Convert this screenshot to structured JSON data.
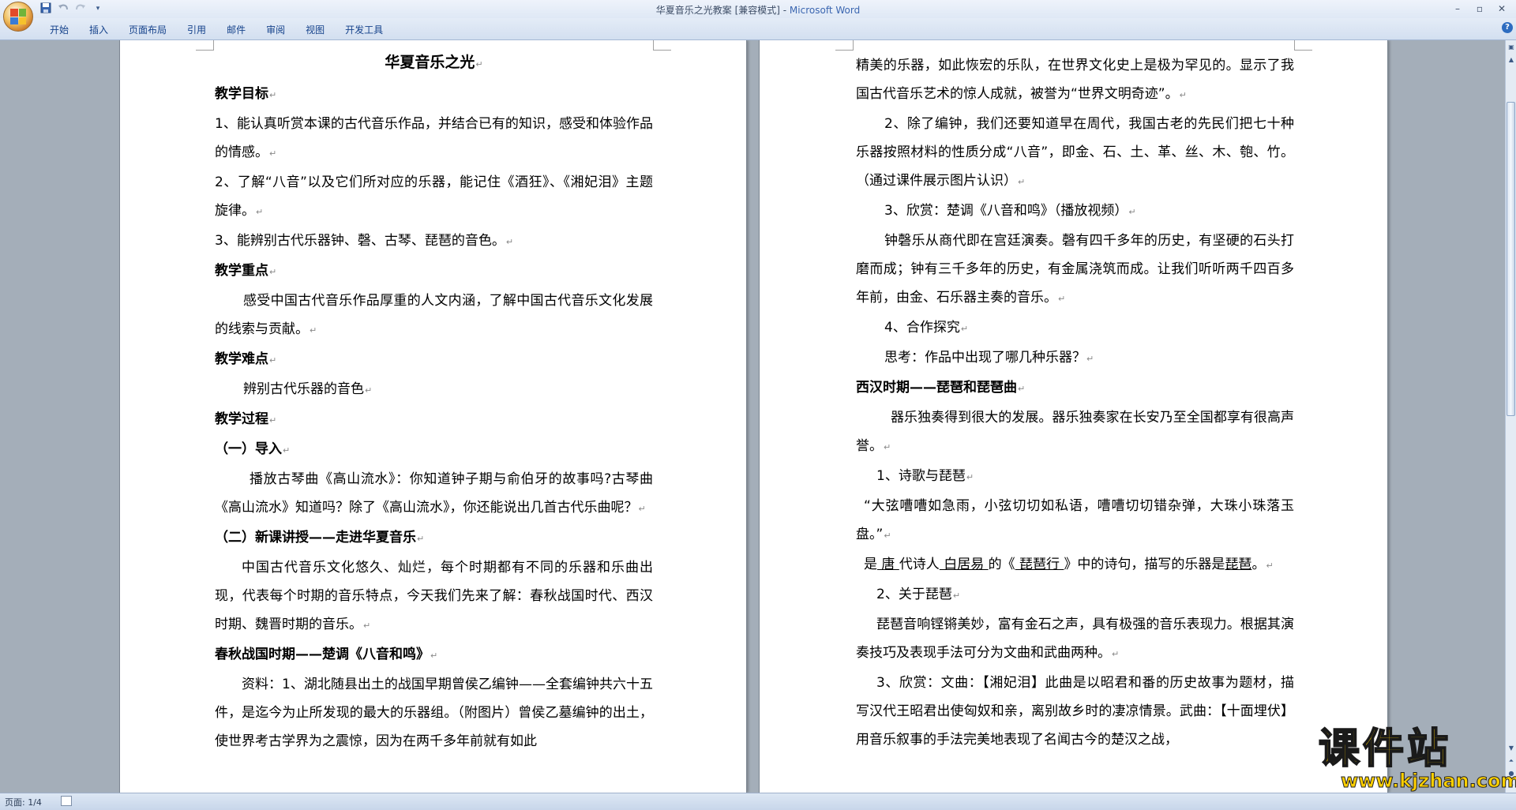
{
  "window": {
    "title": "华夏音乐之光教案 [兼容模式] - ",
    "app_name": "Microsoft Word"
  },
  "qat": {
    "save_icon": "save-icon",
    "undo_icon": "undo-icon",
    "redo_icon": "redo-icon",
    "customize_icon": "chevron-down-icon"
  },
  "ribbon": {
    "tabs": [
      "开始",
      "插入",
      "页面布局",
      "引用",
      "邮件",
      "审阅",
      "视图",
      "开发工具"
    ]
  },
  "page1": {
    "title": "华夏音乐之光",
    "paragraphs": [
      "教学目标",
      "1、能认真听赏本课的古代音乐作品，并结合已有的知识，感受和体验作品的情感。",
      "2、了解“八音”以及它们所对应的乐器，能记住《酒狂》、《湘妃泪》主题旋律。",
      "3、能辨别古代乐器钟、磬、古琴、琵琶的音色。",
      "教学重点",
      "感受中国古代音乐作品厚重的人文内涵，了解中国古代音乐文化发展的线索与贡献。",
      "教学难点",
      "辨别古代乐器的音色",
      "教学过程",
      "（一）导入",
      "播放古琴曲《高山流水》：你知道钟子期与俞伯牙的故事吗?古琴曲《高山流水》知道吗？除了《高山流水》，你还能说出几首古代乐曲呢？",
      "（二）新课讲授——走进华夏音乐",
      "中国古代音乐文化悠久、灿烂，每个时期都有不同的乐器和乐曲出现，代表每个时期的音乐特点，今天我们先来了解：春秋战国时代、西汉时期、魏晋时期的音乐。",
      "春秋战国时期——楚调《八音和鸣》",
      "资料：1、湖北随县出土的战国早期曾侯乙编钟——全套编钟共六十五件，是迄今为止所发现的最大的乐器组。（附图片）曾侯乙墓编钟的出土，使世界考古学界为之震惊，因为在两千多年前就有如此"
    ]
  },
  "page2": {
    "paragraphs": [
      "精美的乐器，如此恢宏的乐队，在世界文化史上是极为罕见的。显示了我国古代音乐艺术的惊人成就，被誉为“世界文明奇迹”。",
      "2、除了编钟，我们还要知道早在周代，我国古老的先民们把七十种乐器按照材料的性质分成“八音”，即金、石、土、革、丝、木、匏、竹。（通过课件展示图片认识）",
      "3、欣赏：楚调《八音和鸣》（播放视频）",
      "钟磬乐从商代即在宫廷演奏。磬有四千多年的历史，有坚硬的石头打磨而成；钟有三千多年的历史，有金属浇筑而成。让我们听听两千四百多年前，由金、石乐器主奏的音乐。",
      "4、合作探究",
      "思考：作品中出现了哪几种乐器？",
      "西汉时期——琵琶和琵琶曲",
      "器乐独奏得到很大的发展。器乐独奏家在长安乃至全国都享有很高声誉。",
      "1、诗歌与琵琶",
      "“大弦嘈嘈如急雨，小弦切切如私语，嘈嘈切切错杂弹，大珠小珠落玉盘。”",
      "",
      "2、关于琵琶",
      "琵琶音响铿锵美妙，富有金石之声，具有极强的音乐表现力。根据其演奏技巧及表现手法可分为文曲和武曲两种。",
      "3、欣赏：文曲：【湘妃泪】此曲是以昭君和番的历史故事为题材，描写汉代王昭君出使匈奴和亲，离别故乡时的凄凉情景。武曲：【十面埋伏】用音乐叙事的手法完美地表现了名闻古今的楚汉之战，"
    ],
    "fill_blank": {
      "p1": "是",
      "dynasty": " 唐 ",
      "p2": "代诗人",
      "poet": " 白居易 ",
      "p3": "的《",
      "poem": " 琵琶行 ",
      "p4": "》中的诗句，描写的乐器是",
      "instrument": "琵琶",
      "p5": "。"
    }
  },
  "statusbar": {
    "page_label": "页面: 1/4"
  },
  "watermark": {
    "text": "课件站",
    "url": "www.kjzhan.com"
  },
  "colors": {
    "ribbon_text": "#15428b",
    "app_name": "#3b66b0",
    "watermark": "#ffd000",
    "workspace": "#a4aeb9"
  }
}
